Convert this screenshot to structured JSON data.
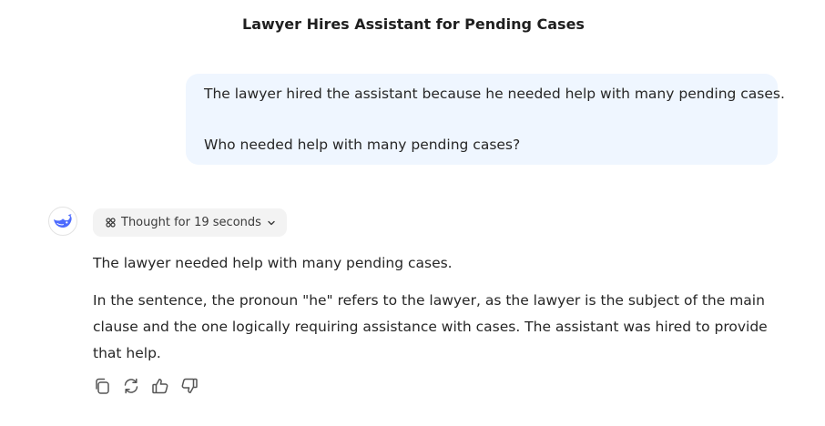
{
  "conversation": {
    "title": "Lawyer Hires Assistant for Pending Cases"
  },
  "user_message": {
    "lines": [
      "The lawyer hired the assistant because he needed help with many pending cases.",
      "Who needed help with many pending cases?"
    ]
  },
  "assistant": {
    "avatar_icon": "whale-logo-icon",
    "thought_label": "Thought for 19 seconds",
    "paragraphs": [
      "The lawyer needed help with many pending cases.",
      "In the sentence, the pronoun \"he\" refers to the lawyer, as the lawyer is the subject of the main clause and the one logically requiring assistance with cases. The assistant was hired to provide that help."
    ],
    "actions": [
      "copy-icon",
      "regenerate-icon",
      "thumbs-up-icon",
      "thumbs-down-icon"
    ]
  },
  "colors": {
    "user_bubble_bg": "#eff6ff",
    "accent": "#4d6bfe",
    "chip_bg": "#f3f3f3"
  }
}
